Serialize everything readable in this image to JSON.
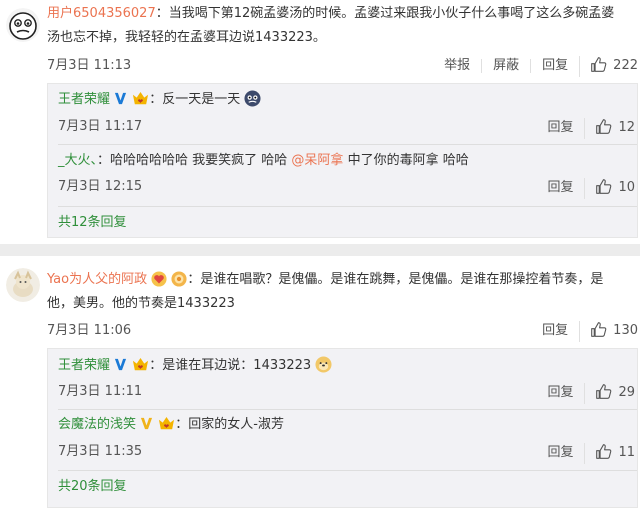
{
  "comments": [
    {
      "username": "用户6504356027",
      "content": "：当我喝下第12碗孟婆汤的时候。孟婆过来跟我小伙子什么事喝了这么多碗孟婆汤也忘不掉，我轻轻的在孟婆耳边说1433223。",
      "content_line1": "：当我喝下第12碗孟婆汤的时候。孟婆过来跟我小伙子什么事喝了这么多碗孟婆",
      "content_line2": "汤也忘不掉，我轻轻的在孟婆耳边说1433223。",
      "date": "7月3日 11:13",
      "actions": {
        "report": "举报",
        "block": "屏蔽",
        "reply": "回复"
      },
      "likes": "222",
      "replies": [
        {
          "username": "王者荣耀",
          "content": "：反一天是一天",
          "date": "7月3日 11:17",
          "reply_label": "回复",
          "likes": "12"
        },
        {
          "username": "_大火、",
          "content_a": "：哈哈哈哈哈哈 我要笑疯了  哈哈 ",
          "mention": "@呆阿拿",
          "content_b": "  中了你的毒阿拿  哈哈",
          "date": "7月3日 12:15",
          "reply_label": "回复",
          "likes": "10"
        }
      ],
      "more_replies": "共12条回复"
    },
    {
      "username": "Yao为人父的阿政",
      "content_line1": "：是谁在唱歌？是傀儡。是谁在跳舞，是傀儡。是谁在那操控着节奏，是",
      "content_line2": "他，美男。他的节奏是1433223",
      "date": "7月3日 11:06",
      "actions": {
        "reply": "回复"
      },
      "likes": "130",
      "replies": [
        {
          "username": "王者荣耀",
          "content": "：是谁在耳边说：1433223",
          "date": "7月3日 11:11",
          "reply_label": "回复",
          "likes": "29"
        },
        {
          "username": "会魔法的浅笑",
          "content": "：回家的女人-淑芳",
          "date": "7月3日 11:35",
          "reply_label": "回复",
          "likes": "11"
        }
      ],
      "more_replies": "共20条回复"
    }
  ],
  "icons": {
    "like": "thumbs-up-icon",
    "verified": "verified-v-icon",
    "vip": "vip-crown-icon"
  },
  "colors": {
    "username": "#eb7350",
    "reply_username": "#2f8f3a",
    "replies_bg": "#f2f2f5",
    "separator": "#ececec",
    "verified_blue": "#1b7ad6",
    "verified_gold": "#f0b31a"
  }
}
